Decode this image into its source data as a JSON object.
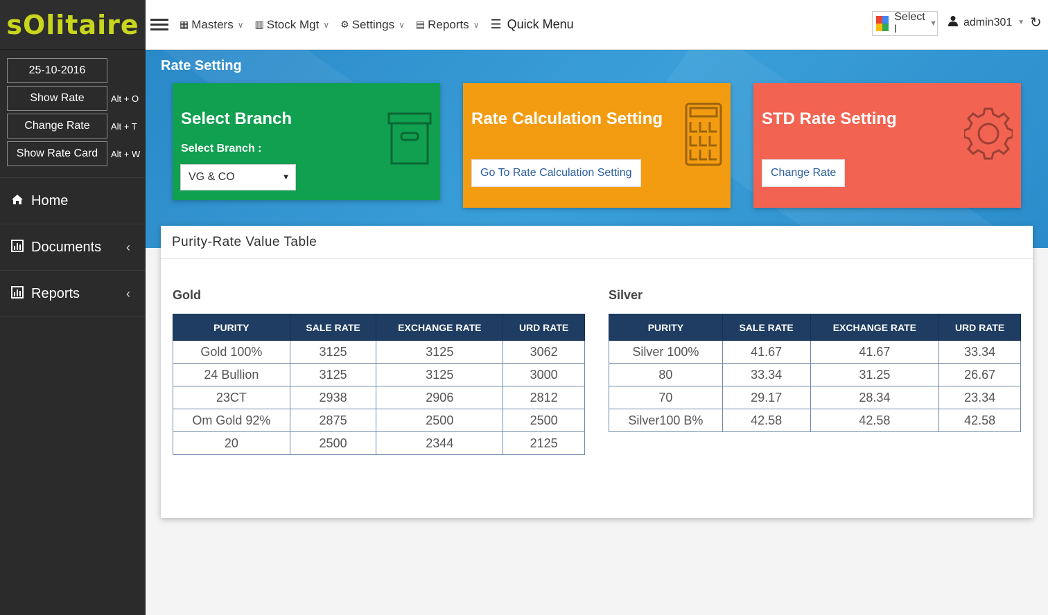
{
  "app": {
    "logo": "sOlitaire"
  },
  "sidebar": {
    "date": "25-10-2016",
    "quick": [
      {
        "label": "Show Rate",
        "key": "Alt + O"
      },
      {
        "label": "Change Rate",
        "key": "Alt + T"
      },
      {
        "label": "Show Rate Card",
        "key": "Alt + W"
      }
    ],
    "nav": [
      {
        "label": "Home",
        "icon": "home-icon"
      },
      {
        "label": "Documents",
        "icon": "chart-icon"
      },
      {
        "label": "Reports",
        "icon": "chart-icon"
      }
    ]
  },
  "topbar": {
    "menus": [
      {
        "label": "Masters",
        "icon": "grid-icon"
      },
      {
        "label": "Stock Mgt",
        "icon": "chart-icon"
      },
      {
        "label": "Settings",
        "icon": "gear-icon"
      },
      {
        "label": "Reports",
        "icon": "file-icon"
      }
    ],
    "quick_menu": "Quick Menu",
    "translate_select": "Select l",
    "user": "admin301"
  },
  "banner": {
    "title": "Rate Setting",
    "cards": {
      "branch": {
        "title": "Select Branch",
        "label": "Select Branch :",
        "value": "VG & CO"
      },
      "calc": {
        "title": "Rate Calculation Setting",
        "button": "Go To Rate Calculation Setting"
      },
      "std": {
        "title": "STD Rate Setting",
        "button": "Change Rate"
      }
    }
  },
  "panel": {
    "title": "Purity-Rate Value Table",
    "columns": [
      "PURITY",
      "SALE RATE",
      "EXCHANGE RATE",
      "URD RATE"
    ],
    "gold": {
      "title": "Gold",
      "rows": [
        [
          "Gold 100%",
          "3125",
          "3125",
          "3062"
        ],
        [
          "24 Bullion",
          "3125",
          "3125",
          "3000"
        ],
        [
          "23CT",
          "2938",
          "2906",
          "2812"
        ],
        [
          "Om Gold 92%",
          "2875",
          "2500",
          "2500"
        ],
        [
          "20",
          "2500",
          "2344",
          "2125"
        ]
      ]
    },
    "silver": {
      "title": "Silver",
      "rows": [
        [
          "Silver 100%",
          "41.67",
          "41.67",
          "33.34"
        ],
        [
          "80",
          "33.34",
          "31.25",
          "26.67"
        ],
        [
          "70",
          "29.17",
          "28.34",
          "23.34"
        ],
        [
          "Silver100 B%",
          "42.58",
          "42.58",
          "42.58"
        ]
      ]
    }
  },
  "colors": {
    "green": "#10a050",
    "orange": "#f39c12",
    "red": "#f26451",
    "header": "#1f3d63",
    "banner": "#2a89c8",
    "sidebar": "#2b2b2b",
    "logo": "#c8d61e"
  }
}
